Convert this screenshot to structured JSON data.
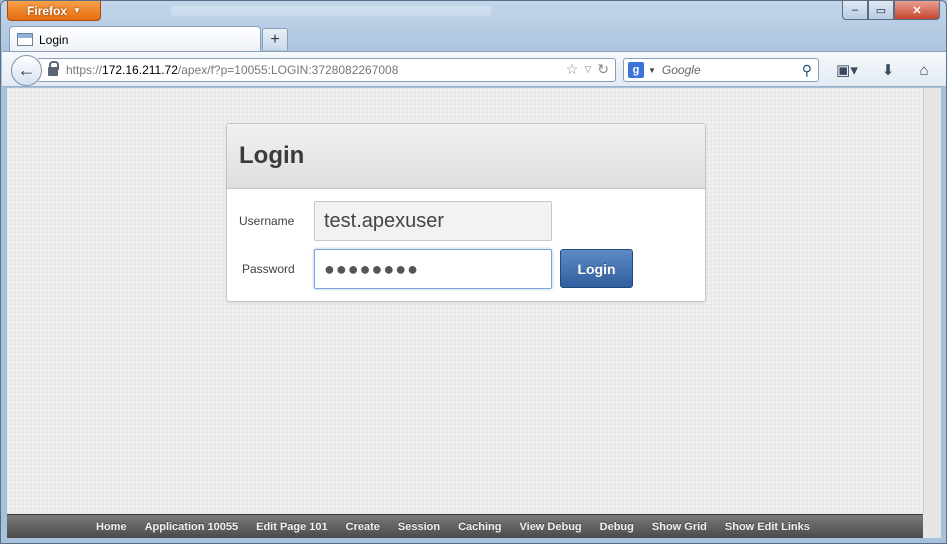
{
  "browser": {
    "app_button": "Firefox",
    "tab_title": "Login",
    "url_scheme": "https://",
    "url_host": "172.16.211.72",
    "url_path": "/apex/f?p=10055:LOGIN:3728082267008",
    "search_placeholder": "Google",
    "search_engine_letter": "g"
  },
  "login": {
    "title": "Login",
    "username_label": "Username",
    "username_value": "test.apexuser",
    "password_label": "Password",
    "password_mask": "●●●●●●●●",
    "submit_label": "Login"
  },
  "dev_toolbar": {
    "items": [
      "Home",
      "Application 10055",
      "Edit Page 101",
      "Create",
      "Session",
      "Caching",
      "View Debug",
      "Debug",
      "Show Grid",
      "Show Edit Links"
    ]
  },
  "colors": {
    "firefox_orange": "#e66b0f",
    "login_button": "#2f5f9c",
    "dev_toolbar": "#4a4a4a"
  },
  "icons": {
    "back": "back-arrow-icon",
    "lock": "lock-icon",
    "bookmark_star": "star-icon",
    "reload": "reload-icon",
    "search": "magnifier-icon",
    "bookmarks_menu": "bookmarks-menu-icon",
    "downloads": "download-arrow-icon",
    "home": "home-icon"
  }
}
